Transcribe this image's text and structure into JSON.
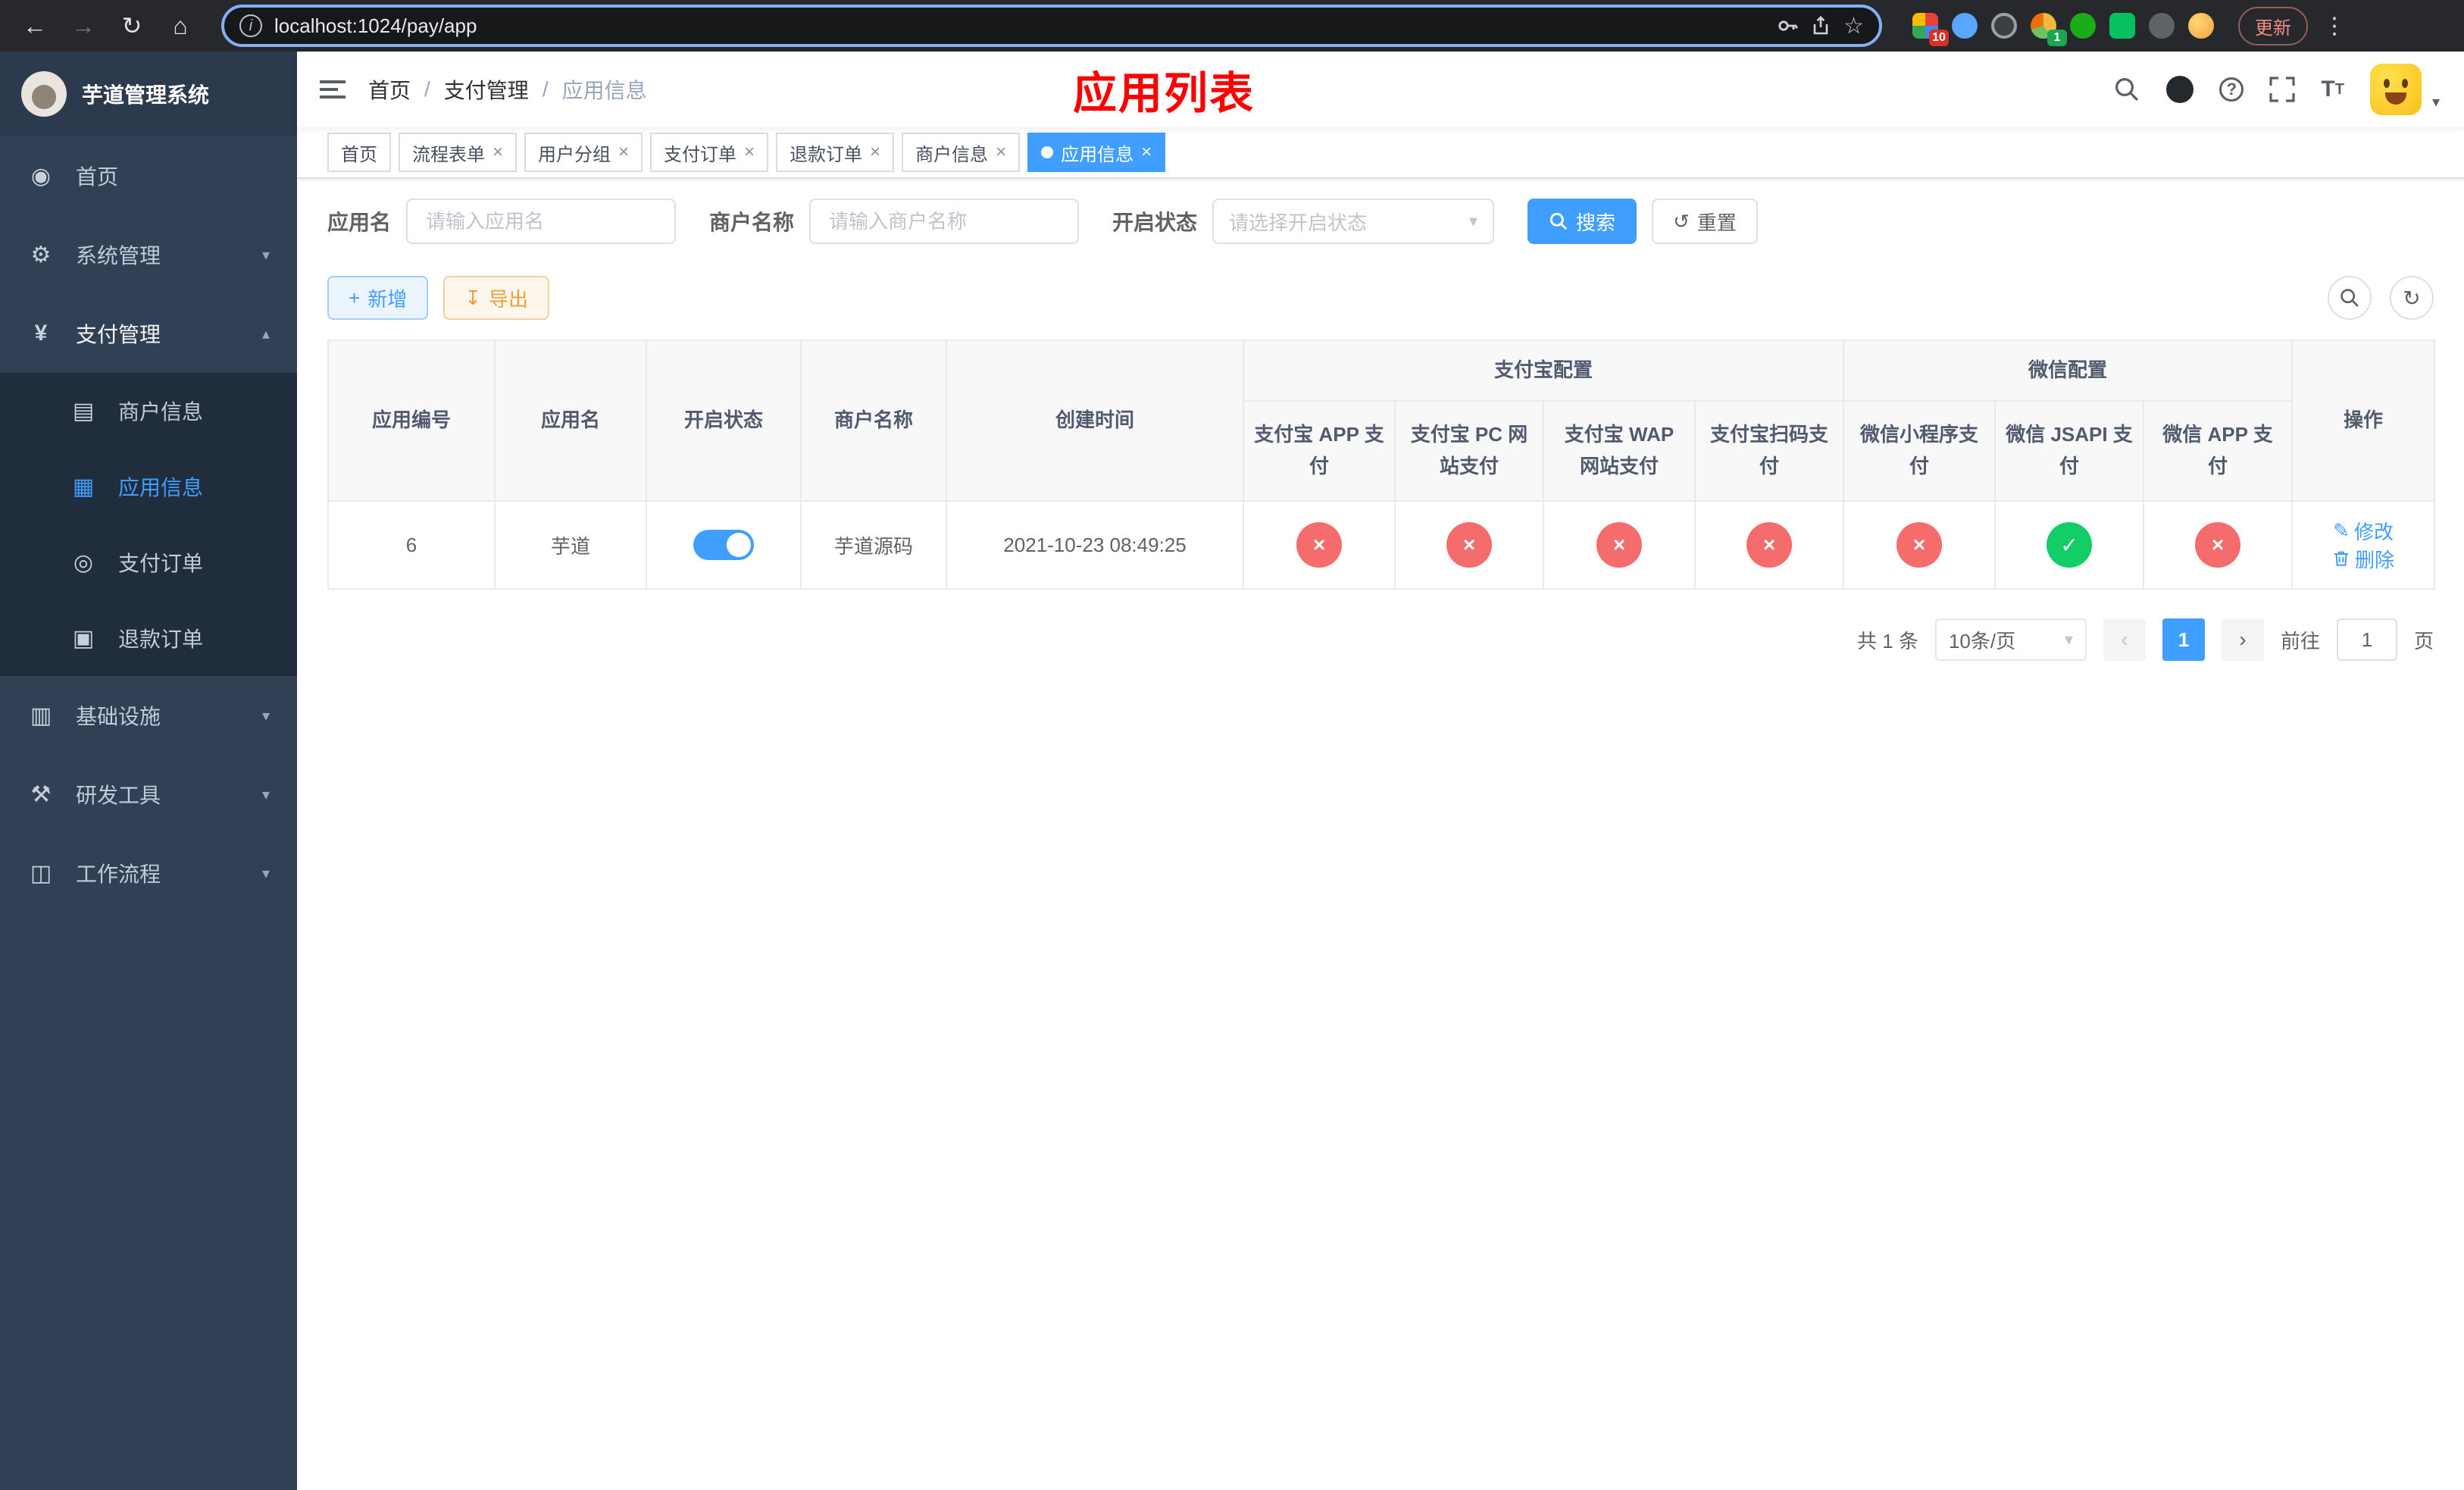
{
  "browser": {
    "url": "localhost:1024/pay/app",
    "update_label": "更新",
    "ext_badge_red": "10",
    "ext_badge_green": "1"
  },
  "sidebar": {
    "title": "芋道管理系统",
    "items": [
      {
        "label": "首页"
      },
      {
        "label": "系统管理"
      },
      {
        "label": "支付管理",
        "children": [
          {
            "label": "商户信息"
          },
          {
            "label": "应用信息"
          },
          {
            "label": "支付订单"
          },
          {
            "label": "退款订单"
          }
        ]
      },
      {
        "label": "基础设施"
      },
      {
        "label": "研发工具"
      },
      {
        "label": "工作流程"
      }
    ]
  },
  "header": {
    "breadcrumb": [
      {
        "label": "首页"
      },
      {
        "label": "支付管理"
      },
      {
        "label": "应用信息"
      }
    ],
    "page_title": "应用列表"
  },
  "tabs": [
    {
      "label": "首页"
    },
    {
      "label": "流程表单"
    },
    {
      "label": "用户分组"
    },
    {
      "label": "支付订单"
    },
    {
      "label": "退款订单"
    },
    {
      "label": "商户信息"
    },
    {
      "label": "应用信息"
    }
  ],
  "filters": {
    "app_name_label": "应用名",
    "app_name_placeholder": "请输入应用名",
    "merchant_name_label": "商户名称",
    "merchant_name_placeholder": "请输入商户名称",
    "status_label": "开启状态",
    "status_placeholder": "请选择开启状态",
    "search_label": "搜索",
    "reset_label": "重置"
  },
  "toolbar": {
    "add_label": "新增",
    "export_label": "导出"
  },
  "table": {
    "headers": {
      "id": "应用编号",
      "name": "应用名",
      "status": "开启状态",
      "merchant": "商户名称",
      "created": "创建时间",
      "alipay_group": "支付宝配置",
      "wechat_group": "微信配置",
      "alipay_app": "支付宝 APP 支付",
      "alipay_pc": "支付宝 PC 网站支付",
      "alipay_wap": "支付宝 WAP 网站支付",
      "alipay_qr": "支付宝扫码支付",
      "wx_lite": "微信小程序支付",
      "wx_jsapi": "微信 JSAPI 支付",
      "wx_app": "微信 APP 支付",
      "op": "操作"
    },
    "rows": [
      {
        "id": "6",
        "app_name": "芋道",
        "status_on": true,
        "merchant_name": "芋道源码",
        "create_time": "2021-10-23 08:49:25",
        "statuses": {
          "alipay_app": false,
          "alipay_pc": false,
          "alipay_wap": false,
          "alipay_qr": false,
          "wx_lite": false,
          "wx_jsapi": true,
          "wx_app": false
        },
        "edit_label": "修改",
        "delete_label": "删除"
      }
    ]
  },
  "pagination": {
    "total_label": "共 1 条",
    "page_size_label": "10条/页",
    "current_page": "1",
    "goto_label": "前往",
    "goto_value": "1",
    "page_unit_label": "页"
  }
}
